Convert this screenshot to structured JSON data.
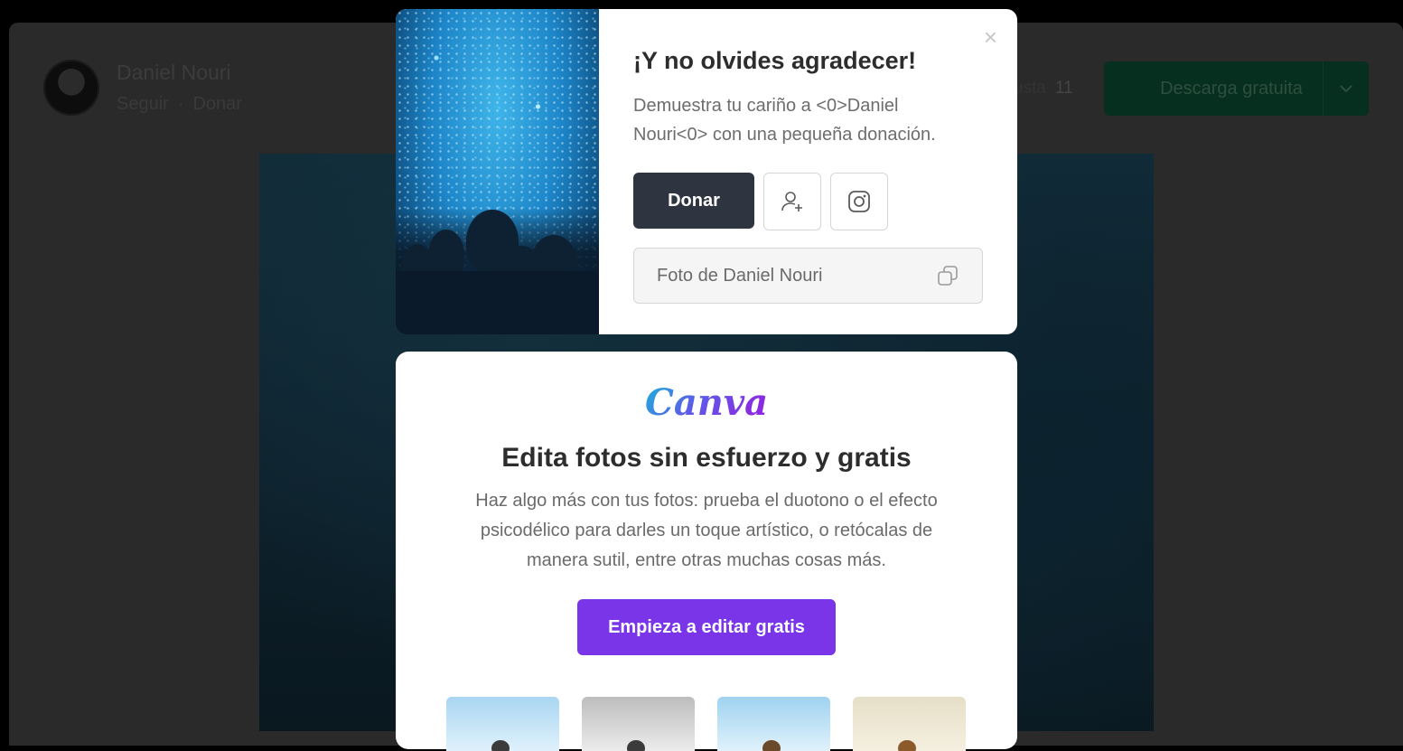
{
  "background": {
    "author_name": "Daniel Nouri",
    "follow_label": "Seguir",
    "separator": "·",
    "donate_label": "Donar",
    "like_label": "usta",
    "like_count": "11",
    "download_label": "Descarga gratuita"
  },
  "thanks_modal": {
    "title": "¡Y no olvides agradecer!",
    "body": "Demuestra tu cariño a <0>Daniel Nouri<0> con una pequeña donación.",
    "donate_button": "Donar",
    "follow_icon": "user-plus-icon",
    "instagram_icon": "instagram-icon",
    "credit_text": "Foto de Daniel Nouri",
    "copy_icon": "copy-icon",
    "close_symbol": "×"
  },
  "canva_modal": {
    "logo_text": "Canva",
    "title": "Edita fotos sin esfuerzo y gratis",
    "description": "Haz algo más con tus fotos: prueba el duotono o el efecto psicodélico para darles un toque artístico, o retócalas de manera sutil, entre otras muchas cosas más.",
    "cta_label": "Empieza a editar gratis",
    "thumbnails": [
      "color",
      "grayscale",
      "color",
      "warm"
    ]
  },
  "colors": {
    "donate_button": "#2f3540",
    "canva_cta": "#7a35e8",
    "download_button": "#062f1f"
  }
}
